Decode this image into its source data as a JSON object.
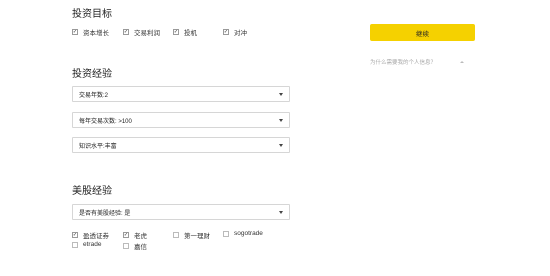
{
  "investment_goals": {
    "title": "投资目标",
    "options": [
      {
        "label": "资本增长",
        "checked": true
      },
      {
        "label": "交易利润",
        "checked": true
      },
      {
        "label": "投机",
        "checked": true
      },
      {
        "label": "对冲",
        "checked": true
      }
    ]
  },
  "experience": {
    "title": "投资经验",
    "selects": [
      {
        "value": "交易年数:2"
      },
      {
        "value": "每年交易次数: >100"
      },
      {
        "value": "知识水平:丰富"
      }
    ]
  },
  "us_stock": {
    "title": "美股经验",
    "select": {
      "value": "是否有美股经验: 是"
    },
    "options": [
      {
        "label": "盈透证券",
        "checked": true
      },
      {
        "label": "老虎",
        "checked": true
      },
      {
        "label": "第一理财",
        "checked": false
      },
      {
        "label": "sogotrade",
        "checked": false
      },
      {
        "label": "etrade",
        "checked": false
      },
      {
        "label": "嘉信",
        "checked": false
      }
    ]
  },
  "sidebar": {
    "continue_label": "继续",
    "help_text": "为什么需要我的个人信息？"
  }
}
